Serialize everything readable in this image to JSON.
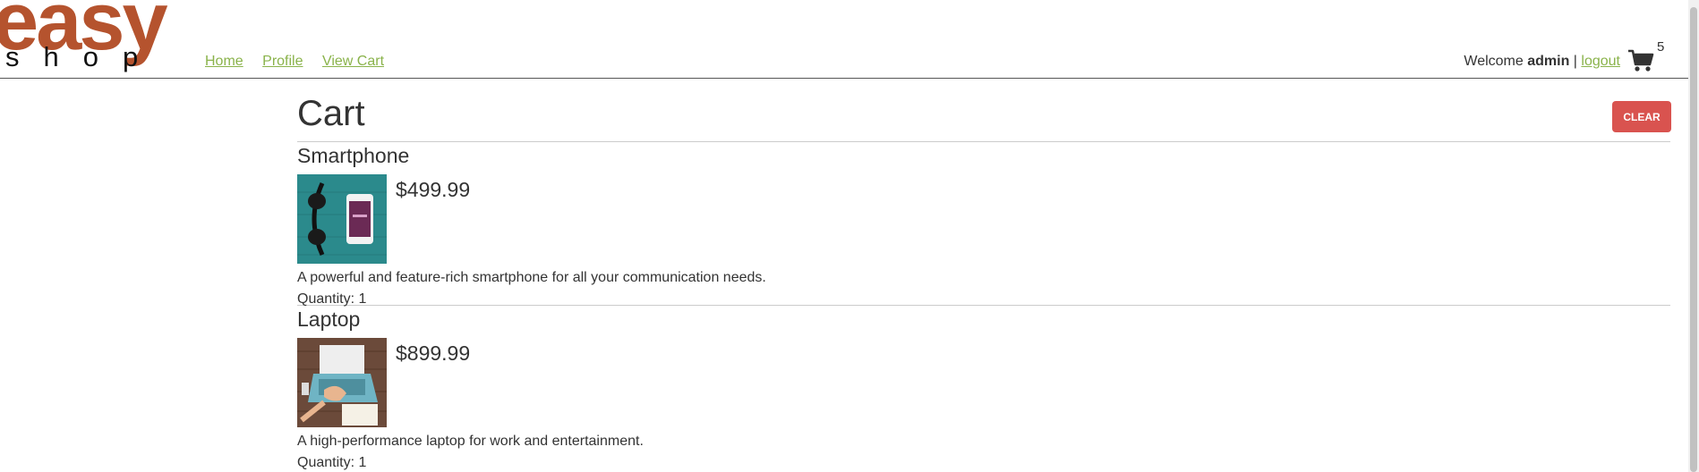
{
  "logo": {
    "top": "easy",
    "bottom": "shop"
  },
  "nav": {
    "home": "Home",
    "profile": "Profile",
    "view_cart": "View Cart"
  },
  "user": {
    "welcome": "Welcome",
    "name": "admin",
    "separator": "|",
    "logout": "logout",
    "cart_count": "5"
  },
  "cart": {
    "title": "Cart",
    "clear_label": "CLEAR",
    "items": [
      {
        "name": "Smartphone",
        "price": "$499.99",
        "description": "A powerful and feature-rich smartphone for all your communication needs.",
        "quantity": "Quantity: 1"
      },
      {
        "name": "Laptop",
        "price": "$899.99",
        "description": "A high-performance laptop for work and entertainment.",
        "quantity": "Quantity: 1"
      }
    ]
  },
  "colors": {
    "brand": "#b5532e",
    "link": "#8ab34b",
    "danger": "#d9534f"
  },
  "icons": {
    "cart": "cart-icon"
  }
}
